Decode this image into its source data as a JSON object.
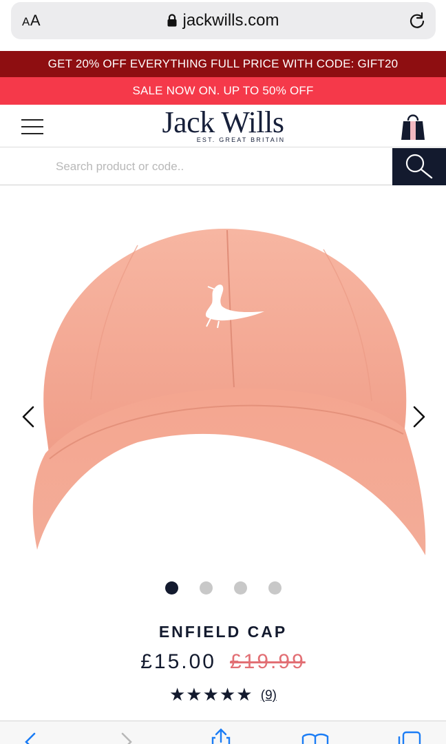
{
  "browser": {
    "aa_label_big": "A",
    "aa_label_small": "A",
    "url": "jackwills.com"
  },
  "promos": {
    "code_banner": "GET 20% OFF EVERYTHING FULL PRICE WITH CODE: GIFT20",
    "sale_banner": "SALE NOW ON. UP TO 50% OFF"
  },
  "header": {
    "logo_main": "Jack Wills",
    "logo_sub": "EST. GREAT BRITAIN"
  },
  "search": {
    "placeholder": "Search product or code.."
  },
  "gallery": {
    "image_count": 4,
    "active_index": 0
  },
  "product": {
    "name": "ENFIELD CAP",
    "price_now": "£15.00",
    "price_was": "£19.99",
    "stars": "★★★★★",
    "rating": 5,
    "review_count": "(9)"
  },
  "colors": {
    "navy": "#131a2e",
    "promo_dark_red": "#8e0e11",
    "promo_red": "#f5394a",
    "cap_pink": "#f2a48f",
    "was_price_red": "#e26f74",
    "safari_blue": "#1a7cf5"
  }
}
